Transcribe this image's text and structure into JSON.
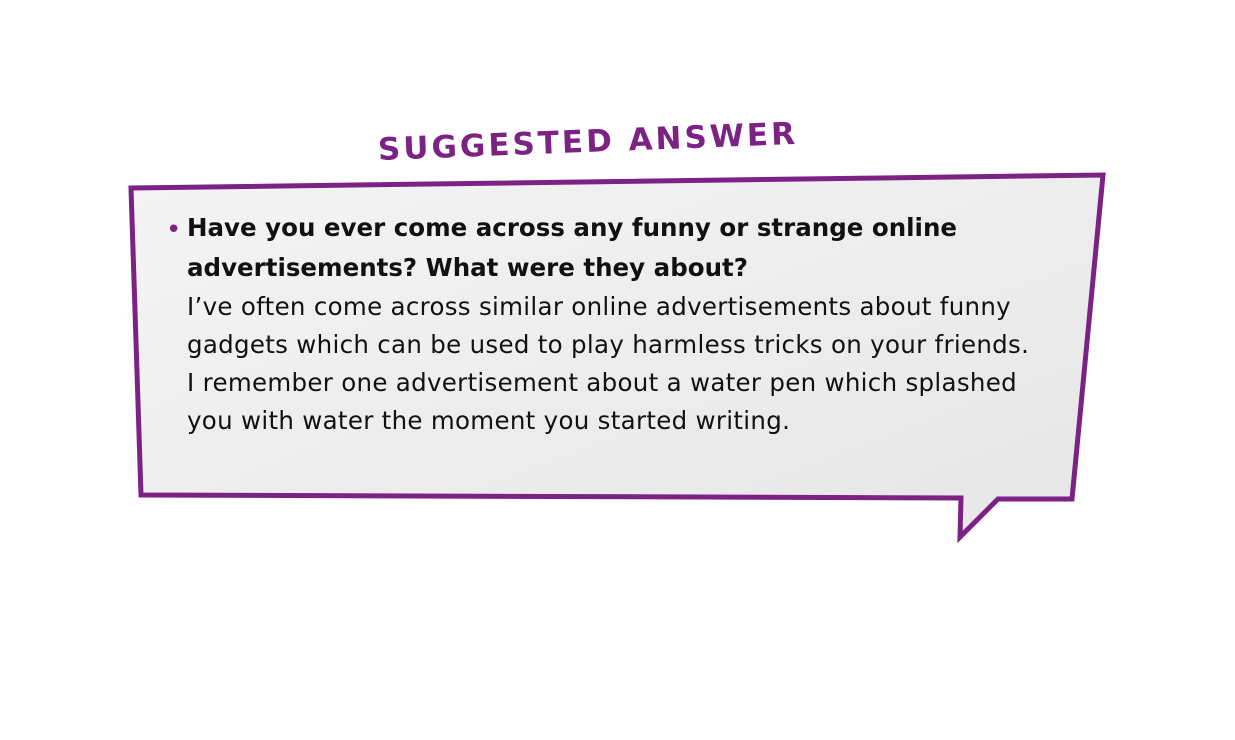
{
  "heading": "SUGGESTED ANSWER",
  "question": "Have you ever come across any funny or strange online advertisements? What were they about?",
  "answer": "I’ve often come across similar online advertisements about funny gadgets which can be used to play harmless tricks on your friends. I remember one advertisement about a water pen which splashed you with water the moment you started writing.",
  "bullet": "•",
  "colors": {
    "accent": "#7b2284",
    "bubble_fill": "#ededed",
    "text": "#111111"
  }
}
